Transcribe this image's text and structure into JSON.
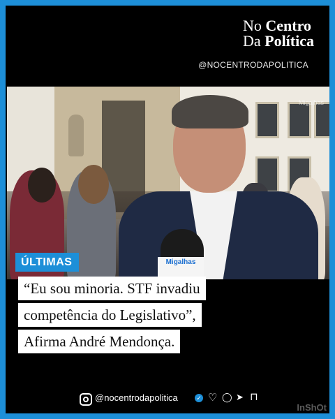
{
  "brand": {
    "line1_a": "No ",
    "line1_b": "Centro",
    "line2_a": "Da ",
    "line2_b": "Política"
  },
  "handle_top": "@NOCENTRODAPOLITICA",
  "photo": {
    "mic_label": "Migalhas",
    "watermark": "Migalhas"
  },
  "badge": "ÚLTIMAS",
  "quote": {
    "line1": "“Eu sou minoria. STF invadiu",
    "line2": "competência do Legislativo”,",
    "line3": "Afirma André Mendonça."
  },
  "footer": {
    "handle": "@nocentrodapolitica",
    "verified_mark": "✓",
    "icons": [
      "instagram-icon",
      "heart-icon",
      "comment-icon",
      "share-icon",
      "bookmark-icon"
    ],
    "heart": "♡",
    "comment": "◯",
    "share": "➤",
    "bookmark": "⊓"
  },
  "inshot": "InShOt",
  "colors": {
    "frame_border": "#1d8fd8",
    "badge_bg": "#1d8fd8",
    "background": "#000000"
  }
}
